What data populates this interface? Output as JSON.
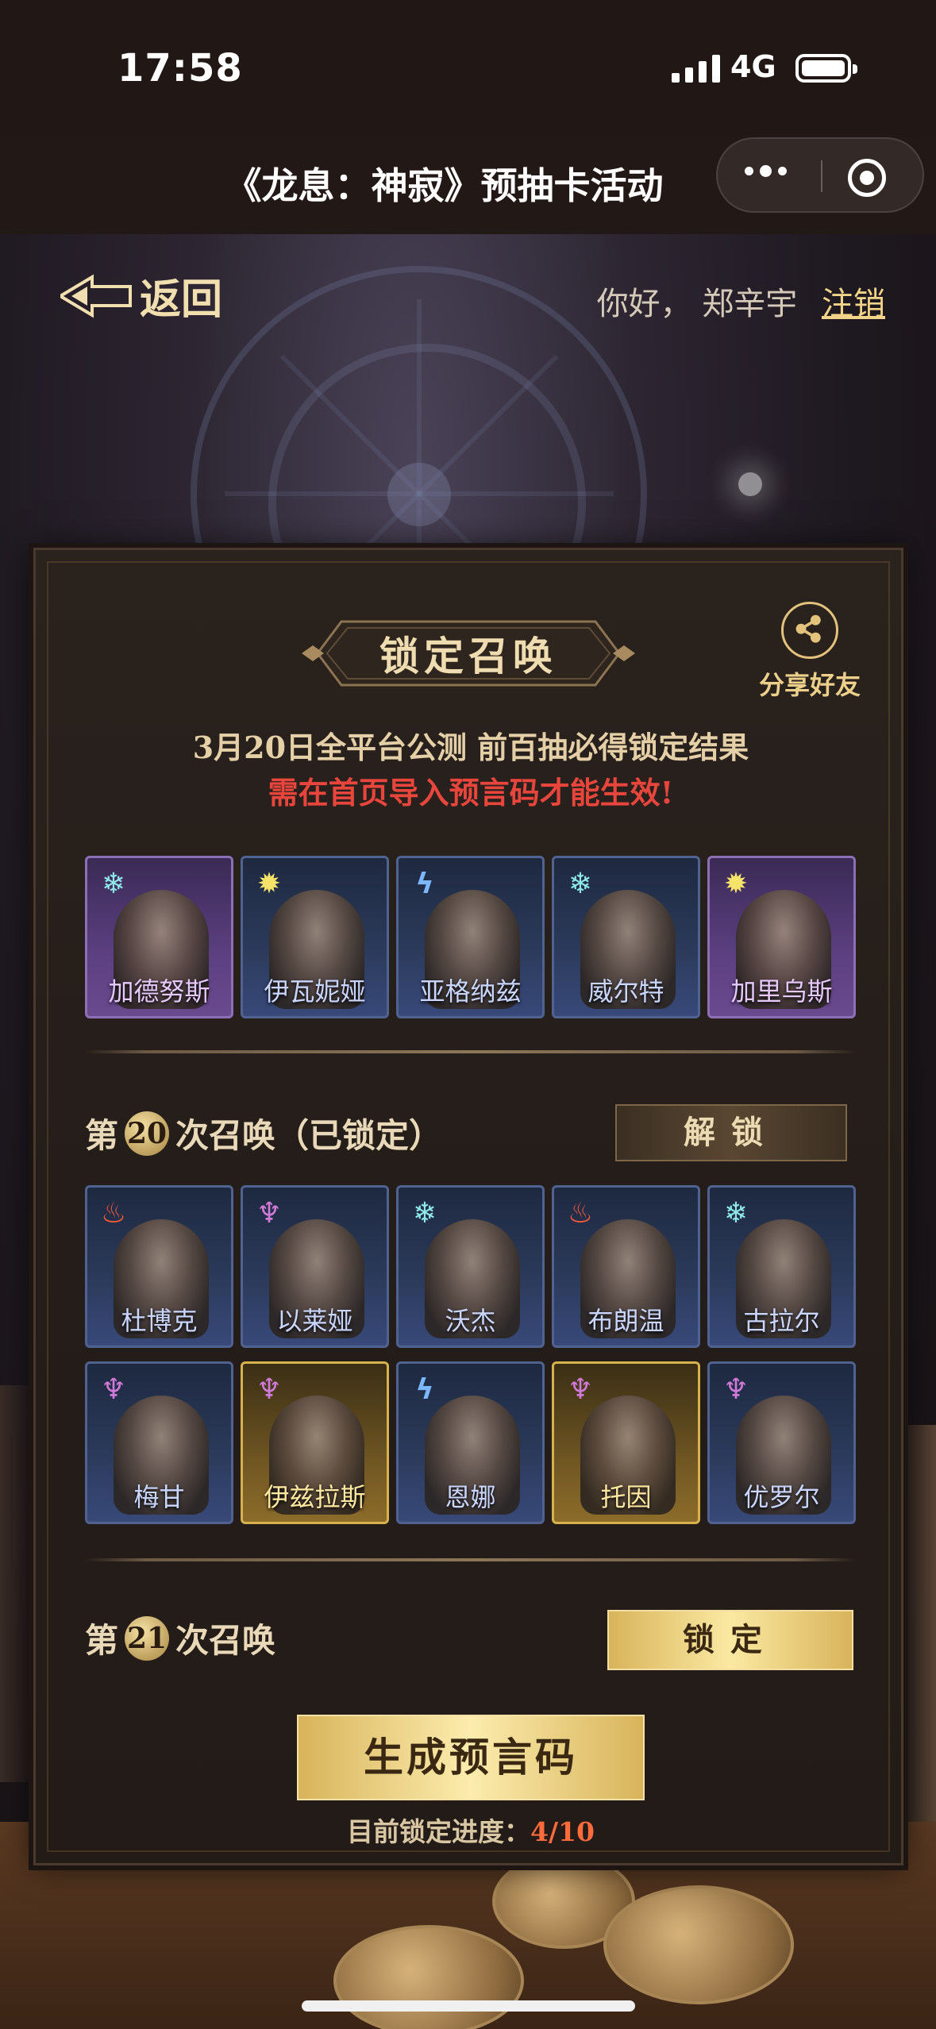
{
  "status_bar": {
    "time": "17:58",
    "network": "4G"
  },
  "header": {
    "title": "《龙息：神寂》预抽卡活动"
  },
  "nav": {
    "back_label": "返回",
    "greeting": "你好，  郑辛宇",
    "logout_label": "注销"
  },
  "panel": {
    "title": "锁定召唤",
    "share_label": "分享好友",
    "notice_line1": "3月20日全平台公测 前百抽必得锁定结果",
    "notice_line2": "需在首页导入预言码才能生效!",
    "featured": [
      {
        "name": "加德努斯",
        "element": "ice",
        "rarity": "purple"
      },
      {
        "name": "伊瓦妮娅",
        "element": "sun",
        "rarity": "blue"
      },
      {
        "name": "亚格纳兹",
        "element": "bolt",
        "rarity": "blue"
      },
      {
        "name": "威尔特",
        "element": "ice",
        "rarity": "blue"
      },
      {
        "name": "加里乌斯",
        "element": "sun",
        "rarity": "purple"
      }
    ],
    "round20": {
      "prefix": "第",
      "number": "20",
      "suffix": "次召唤（已锁定）",
      "unlock_label": "解锁",
      "cards": [
        {
          "name": "杜博克",
          "element": "fire",
          "rarity": "blue"
        },
        {
          "name": "以莱娅",
          "element": "demon",
          "rarity": "blue"
        },
        {
          "name": "沃杰",
          "element": "ice",
          "rarity": "blue"
        },
        {
          "name": "布朗温",
          "element": "fire",
          "rarity": "blue"
        },
        {
          "name": "古拉尔",
          "element": "ice",
          "rarity": "blue"
        },
        {
          "name": "梅甘",
          "element": "demon",
          "rarity": "blue"
        },
        {
          "name": "伊兹拉斯",
          "element": "demon",
          "rarity": "gold"
        },
        {
          "name": "恩娜",
          "element": "bolt",
          "rarity": "blue"
        },
        {
          "name": "托因",
          "element": "demon",
          "rarity": "gold"
        },
        {
          "name": "优罗尔",
          "element": "demon",
          "rarity": "blue"
        }
      ]
    },
    "round21": {
      "prefix": "第",
      "number": "21",
      "suffix": "次召唤",
      "lock_label": "锁定"
    },
    "generate_label": "生成预言码",
    "progress_label": "目前锁定进度：",
    "progress_value": "4/10"
  },
  "icons": {
    "ice": "❄",
    "sun": "✹",
    "bolt": "ϟ",
    "fire": "♨",
    "demon": "♆"
  }
}
